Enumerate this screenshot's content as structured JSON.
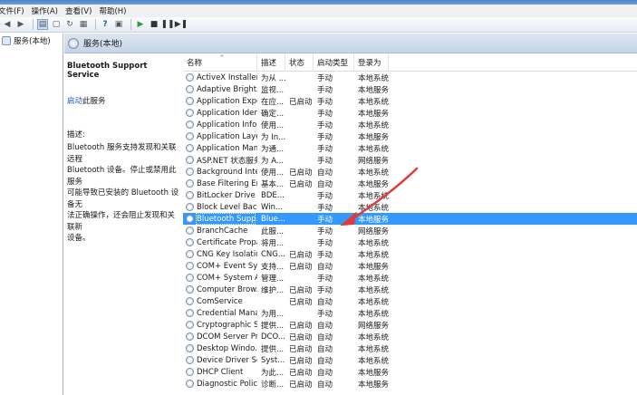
{
  "menu": [
    "文件(F)",
    "操作(A)",
    "查看(V)",
    "帮助(H)"
  ],
  "tree": {
    "label": "服务(本地)"
  },
  "header": {
    "title": "服务(本地)"
  },
  "description": {
    "service_name": "Bluetooth Support Service",
    "start_link": "启动",
    "start_suffix": "此服务",
    "label": "描述:",
    "text": "Bluetooth 服务支持发现和关联远程\nBluetooth 设备。停止或禁用此服务\n可能导致已安装的 Bluetooth 设备无\n法正确操作，还会阻止发现和关联新\n设备。"
  },
  "columns": [
    "名称",
    "描述",
    "状态",
    "启动类型",
    "登录为"
  ],
  "rows": [
    {
      "name": "ActiveX Installer ...",
      "desc": "为从 ...",
      "status": "",
      "startup": "手动",
      "logon": "本地系统"
    },
    {
      "name": "Adaptive Brightn...",
      "desc": "监视...",
      "status": "",
      "startup": "手动",
      "logon": "本地服务"
    },
    {
      "name": "Application Expe...",
      "desc": "在应...",
      "status": "已启动",
      "startup": "手动",
      "logon": "本地系统"
    },
    {
      "name": "Application Iden...",
      "desc": "确定...",
      "status": "",
      "startup": "手动",
      "logon": "本地服务"
    },
    {
      "name": "Application Infor...",
      "desc": "使用...",
      "status": "",
      "startup": "手动",
      "logon": "本地系统"
    },
    {
      "name": "Application Laye...",
      "desc": "为 In...",
      "status": "",
      "startup": "手动",
      "logon": "本地服务"
    },
    {
      "name": "Application Man...",
      "desc": "为通...",
      "status": "",
      "startup": "手动",
      "logon": "本地系统"
    },
    {
      "name": "ASP.NET 状态服务",
      "desc": "为 A...",
      "status": "",
      "startup": "手动",
      "logon": "网络服务"
    },
    {
      "name": "Background Inte...",
      "desc": "使用...",
      "status": "已启动",
      "startup": "自动",
      "logon": "本地系统"
    },
    {
      "name": "Base Filtering En...",
      "desc": "基本...",
      "status": "已启动",
      "startup": "自动",
      "logon": "本地服务"
    },
    {
      "name": "BitLocker Drive ...",
      "desc": "BDE...",
      "status": "",
      "startup": "手动",
      "logon": "本地系统"
    },
    {
      "name": "Block Level Back...",
      "desc": "Win...",
      "status": "",
      "startup": "手动",
      "logon": "本地系统"
    },
    {
      "name": "Bluetooth Supp...",
      "desc": "Blue...",
      "status": "",
      "startup": "手动",
      "logon": "本地服务",
      "selected": true
    },
    {
      "name": "BranchCache",
      "desc": "此服...",
      "status": "",
      "startup": "手动",
      "logon": "网络服务"
    },
    {
      "name": "Certificate Propa...",
      "desc": "将用...",
      "status": "",
      "startup": "手动",
      "logon": "本地系统"
    },
    {
      "name": "CNG Key Isolation",
      "desc": "CNG...",
      "status": "已启动",
      "startup": "手动",
      "logon": "本地系统"
    },
    {
      "name": "COM+ Event Sys...",
      "desc": "支持...",
      "status": "已启动",
      "startup": "自动",
      "logon": "本地服务"
    },
    {
      "name": "COM+ System A...",
      "desc": "管理...",
      "status": "",
      "startup": "手动",
      "logon": "本地系统"
    },
    {
      "name": "Computer Brow...",
      "desc": "维护...",
      "status": "已启动",
      "startup": "手动",
      "logon": "本地系统"
    },
    {
      "name": "ComService",
      "desc": "",
      "status": "已启动",
      "startup": "自动",
      "logon": "本地系统"
    },
    {
      "name": "Credential Mana...",
      "desc": "为用...",
      "status": "",
      "startup": "手动",
      "logon": "本地系统"
    },
    {
      "name": "Cryptographic S...",
      "desc": "提供...",
      "status": "已启动",
      "startup": "自动",
      "logon": "网络服务"
    },
    {
      "name": "DCOM Server Pr...",
      "desc": "DCO...",
      "status": "已启动",
      "startup": "自动",
      "logon": "本地系统"
    },
    {
      "name": "Desktop Windo...",
      "desc": "提供...",
      "status": "已启动",
      "startup": "自动",
      "logon": "本地系统"
    },
    {
      "name": "Device Driver Se...",
      "desc": "Syst...",
      "status": "已启动",
      "startup": "自动",
      "logon": "本地系统"
    },
    {
      "name": "DHCP Client",
      "desc": "为此...",
      "status": "已启动",
      "startup": "自动",
      "logon": "本地服务"
    },
    {
      "name": "Diagnostic Polic...",
      "desc": "诊断...",
      "status": "已启动",
      "startup": "自动",
      "logon": "本地服务"
    }
  ],
  "colors": {
    "selection": "#3399ff",
    "annotation_arrow": "#e03b3b"
  }
}
